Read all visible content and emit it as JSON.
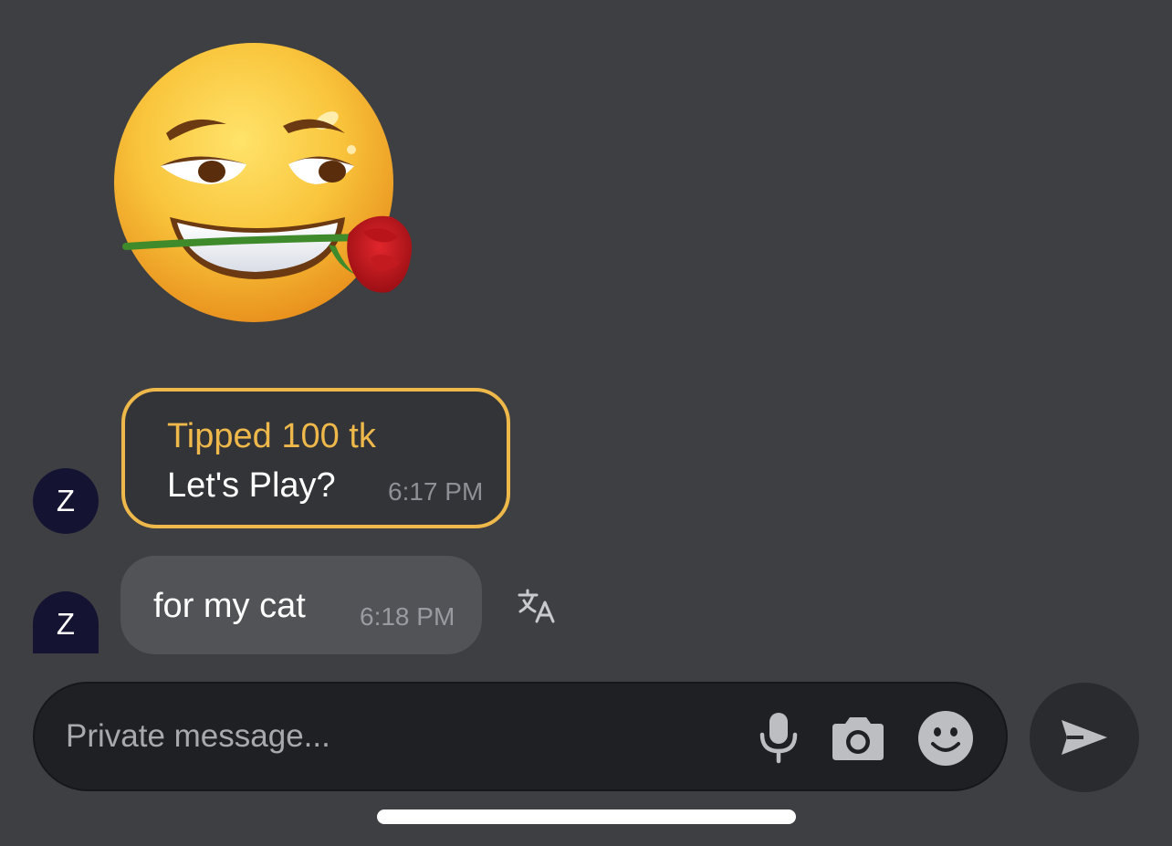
{
  "messages": [
    {
      "avatar_initial": "Z",
      "type": "tip",
      "tip_label": "Tipped 100 tk",
      "text": "Let's Play?",
      "time": "6:17 PM"
    },
    {
      "avatar_initial": "Z",
      "type": "text",
      "text": "for my cat",
      "time": "6:18 PM"
    }
  ],
  "sticker": {
    "icon": "smirking-face-with-rose-sticker"
  },
  "composer": {
    "placeholder": "Private message...",
    "value": ""
  },
  "icons": {
    "translate": "translate-icon",
    "mic": "microphone-icon",
    "camera": "camera-icon",
    "emoji": "emoji-icon",
    "send": "send-icon"
  },
  "colors": {
    "background": "#3e3f43",
    "tip_accent": "#eeb94a",
    "bubble": "#525357",
    "input_bg": "#1f2023",
    "avatar_bg": "#141432"
  }
}
